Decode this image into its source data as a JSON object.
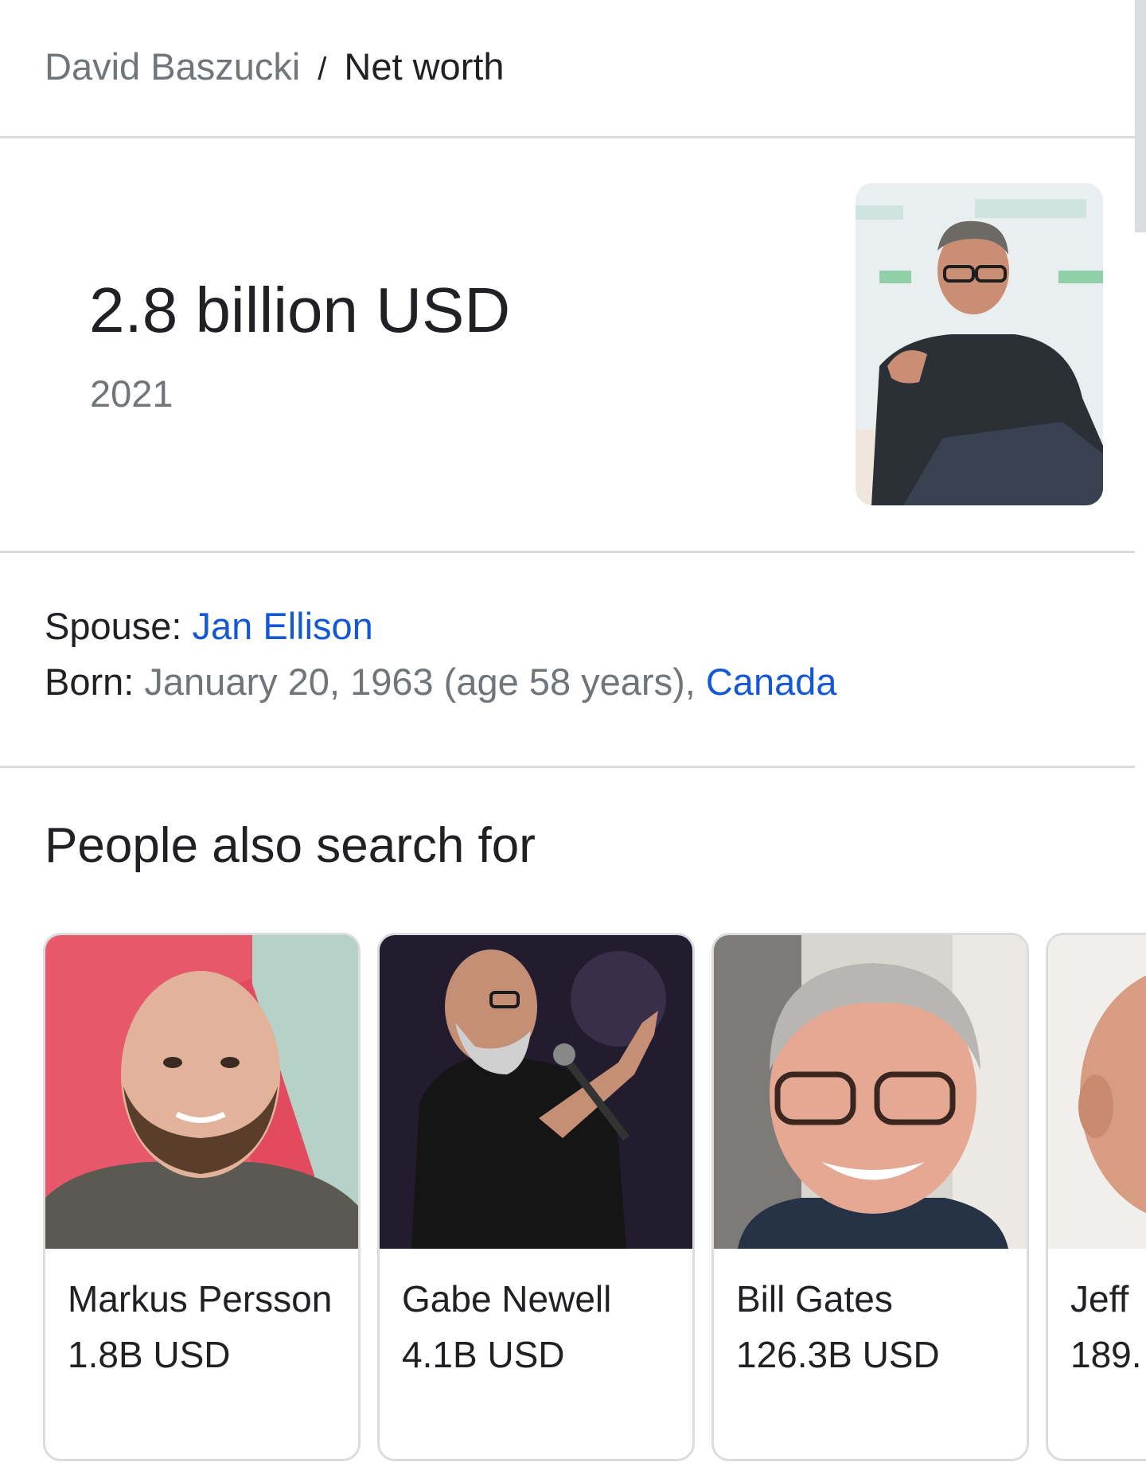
{
  "breadcrumb": {
    "parent": "David Baszucki",
    "separator": "/",
    "current": "Net worth"
  },
  "result": {
    "value": "2.8 billion USD",
    "year": "2021"
  },
  "facts": {
    "spouse_label": "Spouse:",
    "spouse_value": "Jan Ellison",
    "born_label": "Born:",
    "born_value": "January 20, 1963 (age 58 years),",
    "born_place": "Canada"
  },
  "people_section": {
    "title": "People also search for",
    "cards": [
      {
        "name": "Markus Persson",
        "worth": "1.8B USD"
      },
      {
        "name": "Gabe Newell",
        "worth": "4.1B USD"
      },
      {
        "name": "Bill Gates",
        "worth": "126.3B USD"
      },
      {
        "name": "Jeff",
        "worth": "189."
      }
    ]
  },
  "colors": {
    "link": "#1558d6",
    "secondary_text": "#70757a",
    "primary_text": "#202124",
    "divider": "#dadce0"
  }
}
